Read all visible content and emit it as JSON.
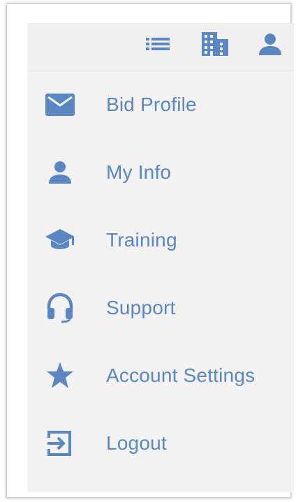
{
  "colors": {
    "accent": "#5a86c2",
    "panel_bg": "#f2f2f3"
  },
  "topbar": {
    "icons": [
      "list-icon",
      "building-icon",
      "person-icon"
    ]
  },
  "menu": {
    "items": [
      {
        "label": "Bid Profile",
        "icon": "envelope-icon"
      },
      {
        "label": "My Info",
        "icon": "person-icon"
      },
      {
        "label": "Training",
        "icon": "graduation-cap-icon"
      },
      {
        "label": "Support",
        "icon": "headset-icon"
      },
      {
        "label": "Account Settings",
        "icon": "star-icon"
      },
      {
        "label": "Logout",
        "icon": "logout-icon"
      }
    ]
  }
}
